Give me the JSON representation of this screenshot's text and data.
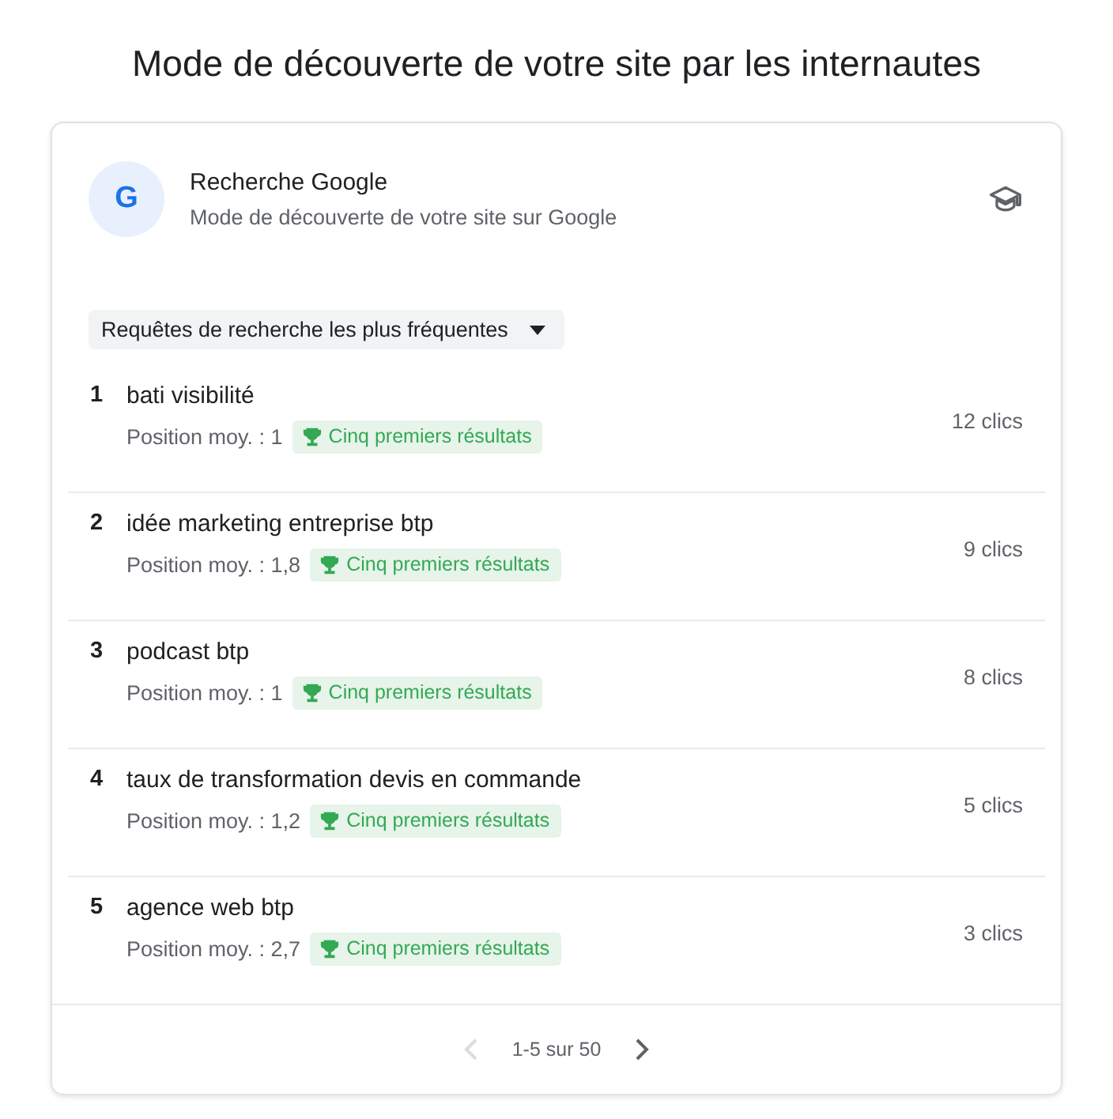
{
  "page_title": "Mode de découverte de votre site par les internautes",
  "card": {
    "logo_letter": "G",
    "title": "Recherche Google",
    "subtitle": "Mode de découverte de votre site sur Google",
    "dropdown": {
      "label": "Requêtes de recherche les plus fréquentes"
    },
    "rows": [
      {
        "rank": "1",
        "query": "bati visibilité",
        "position": "Position moy. : 1",
        "badge": "Cinq premiers résultats",
        "clicks": "12 clics"
      },
      {
        "rank": "2",
        "query": "idée marketing entreprise btp",
        "position": "Position moy. : 1,8",
        "badge": "Cinq premiers résultats",
        "clicks": "9 clics"
      },
      {
        "rank": "3",
        "query": "podcast btp",
        "position": "Position moy. : 1",
        "badge": "Cinq premiers résultats",
        "clicks": "8 clics"
      },
      {
        "rank": "4",
        "query": "taux de transformation devis en commande",
        "position": "Position moy. : 1,2",
        "badge": "Cinq premiers résultats",
        "clicks": "5 clics"
      },
      {
        "rank": "5",
        "query": "agence web btp",
        "position": "Position moy. : 2,7",
        "badge": "Cinq premiers résultats",
        "clicks": "3 clics"
      }
    ],
    "pagination": {
      "label": "1-5 sur 50",
      "prev_disabled": true,
      "next_disabled": false
    }
  }
}
